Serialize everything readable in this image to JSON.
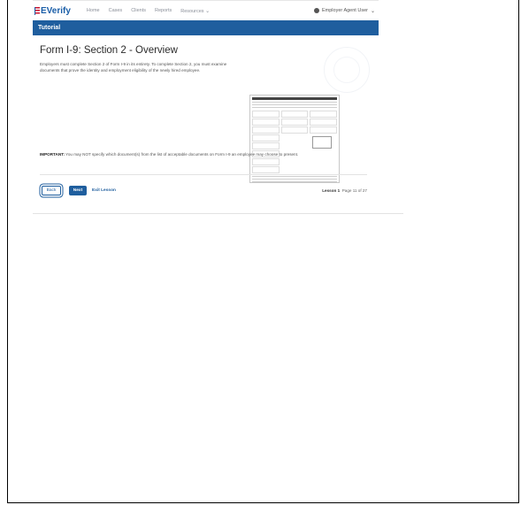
{
  "app": {
    "logo_text": "Verify",
    "logo_prefix": "E"
  },
  "nav": {
    "items": [
      "Home",
      "Cases",
      "Clients",
      "Reports",
      "Resources"
    ],
    "user_label": "Employer Agent User"
  },
  "banner": {
    "title": "Tutorial"
  },
  "page": {
    "title": "Form I-9: Section 2 - Overview",
    "lead": "Employers must complete Section 2 of Form I-9 in its entirety. To complete Section 2, you must examine documents that prove the identity and employment eligibility of the newly hired employee.",
    "important_label": "IMPORTANT:",
    "important_text": " You may NOT specify which document(s) from the list of acceptable documents on Form I-9 an employee may choose to present."
  },
  "footer": {
    "back_label": "Back",
    "next_label": "Next",
    "exit_label": "Exit Lesson",
    "lesson_label": "Lesson 1",
    "page_label": "Page 11 of 27"
  },
  "colors": {
    "brand_blue": "#1f5e9e",
    "logo_blue": "#1a5ea8",
    "logo_red": "#c8102e"
  }
}
